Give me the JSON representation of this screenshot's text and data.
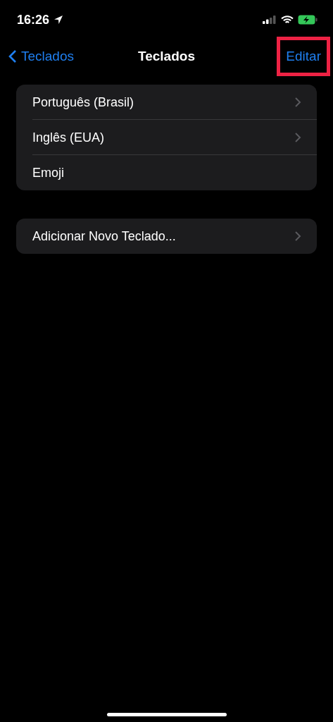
{
  "status_bar": {
    "time": "16:26"
  },
  "nav": {
    "back": "Teclados",
    "title": "Teclados",
    "action": {
      "label": "Editar",
      "highlighted": true
    }
  },
  "groups": [
    {
      "items": [
        {
          "label": "Português (Brasil)",
          "chevron": true
        },
        {
          "label": "Inglês (EUA)",
          "chevron": true
        },
        {
          "label": "Emoji",
          "chevron": false
        }
      ]
    },
    {
      "items": [
        {
          "label": "Adicionar Novo Teclado...",
          "chevron": true
        }
      ]
    }
  ]
}
